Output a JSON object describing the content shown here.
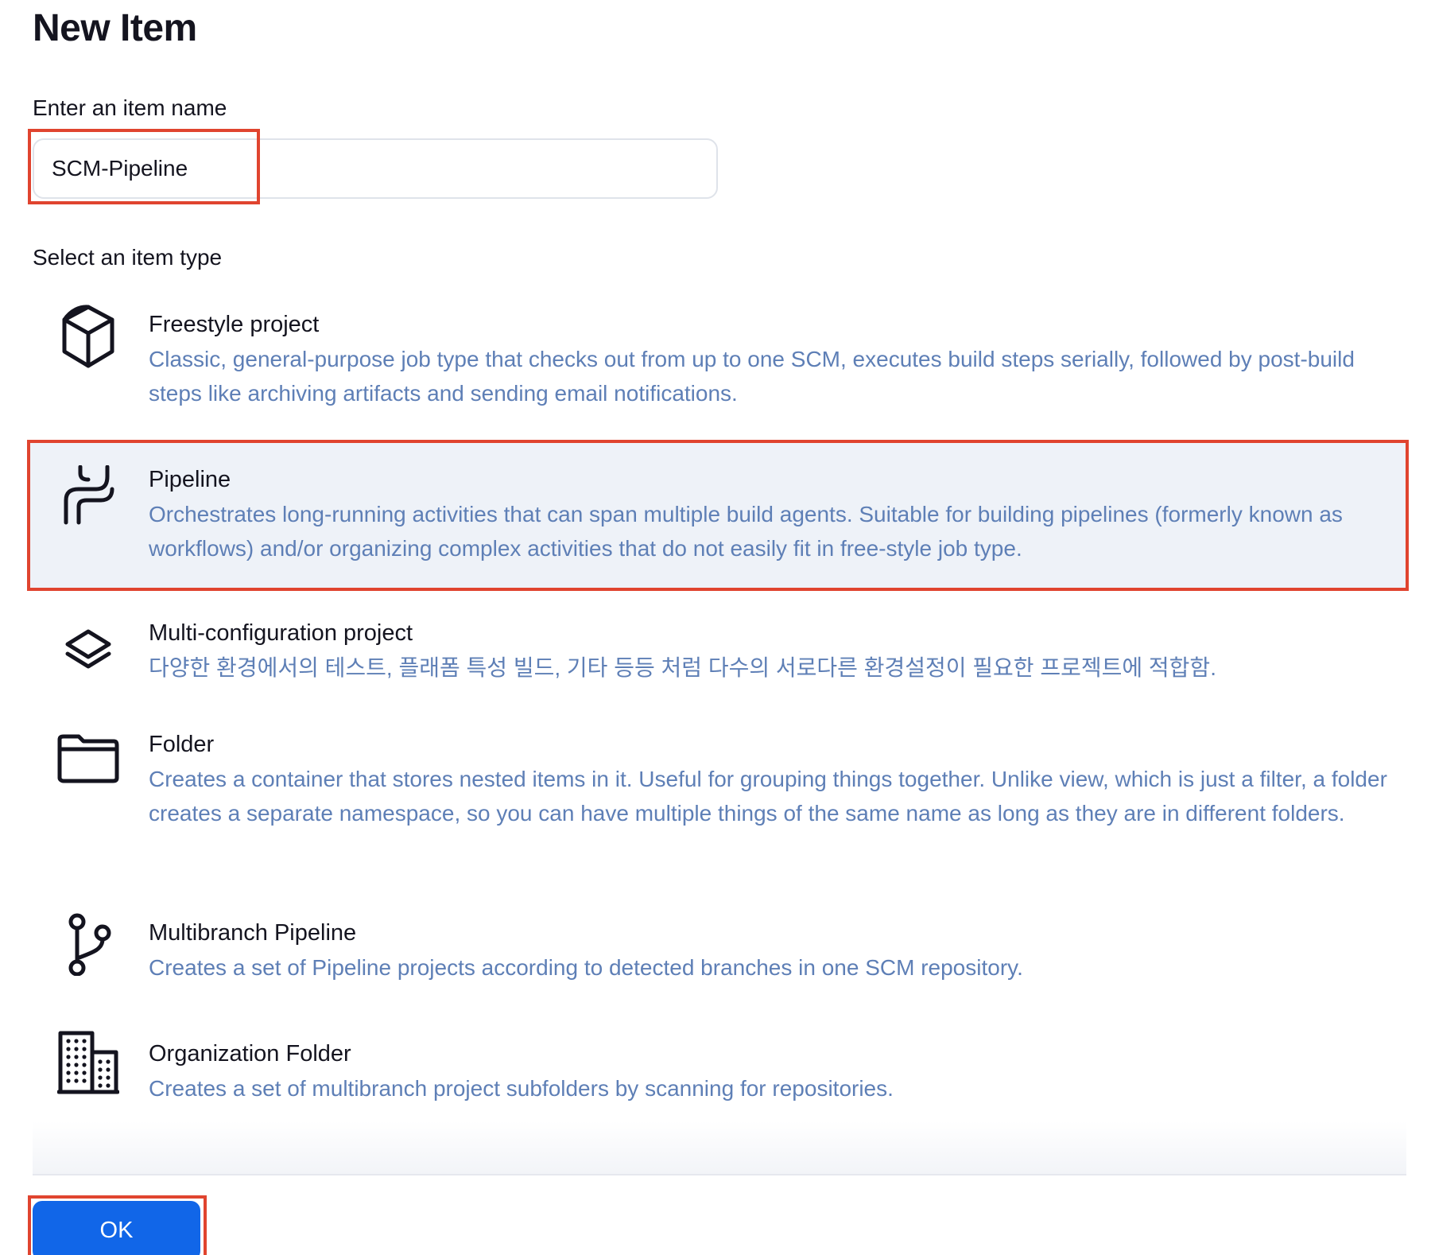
{
  "page": {
    "title": "New Item",
    "name_label": "Enter an item name",
    "name_value": "SCM-Pipeline",
    "type_label": "Select an item type"
  },
  "item_types": [
    {
      "title": "Freestyle project",
      "description": "Classic, general-purpose job type that checks out from up to one SCM, executes build steps serially, followed by post-build steps like archiving artifacts and sending email notifications.",
      "icon": "cube-icon",
      "selected": false
    },
    {
      "title": "Pipeline",
      "description": "Orchestrates long-running activities that can span multiple build agents. Suitable for building pipelines (formerly known as workflows) and/or organizing complex activities that do not easily fit in free-style job type.",
      "icon": "pipeline-icon",
      "selected": true
    },
    {
      "title": "Multi-configuration project",
      "description": "다양한 환경에서의 테스트, 플래폼 특성 빌드, 기타 등등 처럼 다수의 서로다른 환경설정이 필요한 프로젝트에 적합함.",
      "icon": "layers-icon",
      "selected": false
    },
    {
      "title": "Folder",
      "description": "Creates a container that stores nested items in it. Useful for grouping things together. Unlike view, which is just a filter, a folder creates a separate namespace, so you can have multiple things of the same name as long as they are in different folders.",
      "icon": "folder-icon",
      "selected": false
    },
    {
      "title": "Multibranch Pipeline",
      "description": "Creates a set of Pipeline projects according to detected branches in one SCM repository.",
      "icon": "branch-icon",
      "selected": false
    },
    {
      "title": "Organization Folder",
      "description": "Creates a set of multibranch project subfolders by scanning for repositories.",
      "icon": "building-icon",
      "selected": false
    }
  ],
  "footer": {
    "ok_label": "OK"
  },
  "colors": {
    "accent": "#1166e8",
    "highlight": "#e0442f",
    "description": "#5e7fb6",
    "selected_bg": "#eef2f8"
  }
}
